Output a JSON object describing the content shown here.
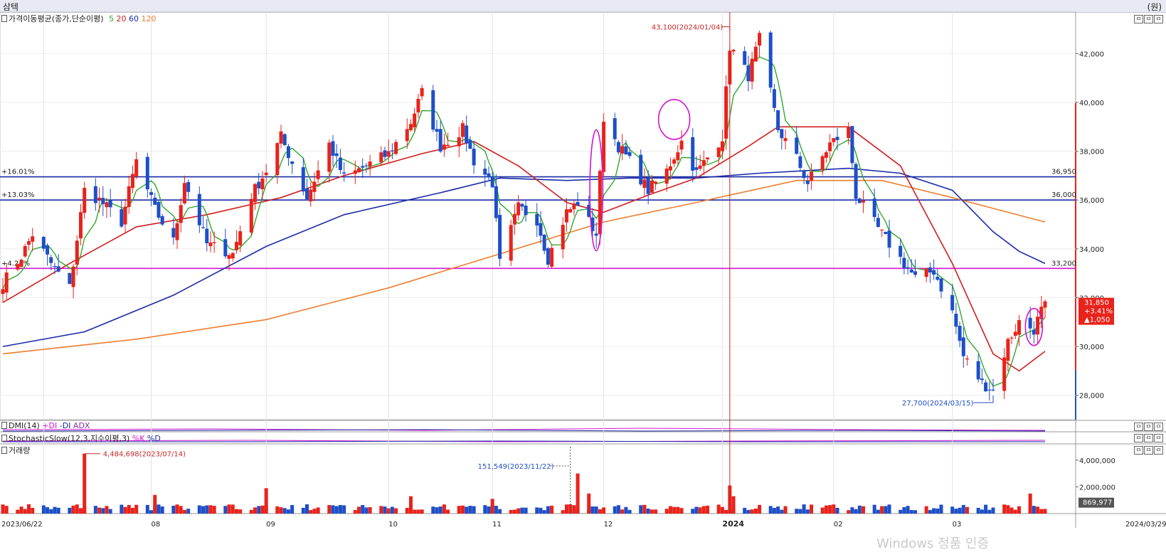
{
  "window": {
    "title": "삼텍",
    "unit": "(원)",
    "buttons": [
      "ㅁ",
      "ㅁ",
      "ㅁ"
    ]
  },
  "panels": {
    "price_label": "가격이동평균(종가,단순이평)",
    "ma_periods": [
      "5",
      "20",
      "60",
      "120"
    ],
    "dmi_label": "DMI(14)",
    "dmi_series": [
      "+DI",
      "-DI",
      "ADX"
    ],
    "stoch_label": "StochasticSlow(12,3,지수이평,3)",
    "stoch_series": [
      "%K",
      "%D"
    ],
    "volume_label": "거래량"
  },
  "watermark": "Windows 정품 인증",
  "colors": {
    "up": "#e8231b",
    "down": "#1e4fc8",
    "ma5": "#2fa82f",
    "ma20": "#d21e1e",
    "ma60": "#1a2aa8",
    "ma120": "#ef7d2e",
    "hline_blue": "#1a2aa8",
    "hline_magenta": "#d214d2",
    "marker": "#c82828",
    "highlight_circle": "#d214d2"
  },
  "chart_data": {
    "type": "candlestick",
    "price_axis": {
      "min": 27000,
      "max": 43700,
      "ticks": [
        28000,
        30000,
        32000,
        34000,
        36000,
        38000,
        40000,
        42000
      ],
      "tick_labels": [
        "28,000",
        "30,000",
        "32,000",
        "34,000",
        "36,000",
        "38,000",
        "40,000",
        "42,000"
      ]
    },
    "date_axis_labels": [
      "2023/06/22",
      "08",
      "09",
      "10",
      "11",
      "12",
      "2024",
      "02",
      "03",
      "2024/03/29"
    ],
    "anchor_points": [
      [
        "2023/06/22",
        32600
      ],
      [
        "2023/06/27",
        33700
      ],
      [
        "2023/06/30",
        34600
      ],
      [
        "2023/07/05",
        33400
      ],
      [
        "2023/07/10",
        32400
      ],
      [
        "2023/07/14",
        36400
      ],
      [
        "2023/07/18",
        36000
      ],
      [
        "2023/07/24",
        35100
      ],
      [
        "2023/07/28",
        37600
      ],
      [
        "2023/08/02",
        35600
      ],
      [
        "2023/08/07",
        34300
      ],
      [
        "2023/08/10",
        36800
      ],
      [
        "2023/08/16",
        34200
      ],
      [
        "2023/08/23",
        33800
      ],
      [
        "2023/08/28",
        36200
      ],
      [
        "2023/09/01",
        37200
      ],
      [
        "2023/09/05",
        38600
      ],
      [
        "2023/09/12",
        36100
      ],
      [
        "2023/09/18",
        38300
      ],
      [
        "2023/09/22",
        36900
      ],
      [
        "2023/10/04",
        37900
      ],
      [
        "2023/10/10",
        39200
      ],
      [
        "2023/10/13",
        40400
      ],
      [
        "2023/10/18",
        38200
      ],
      [
        "2023/10/24",
        38900
      ],
      [
        "2023/10/27",
        37600
      ],
      [
        "2023/11/01",
        36700
      ],
      [
        "2023/11/03",
        33400
      ],
      [
        "2023/11/08",
        35700
      ],
      [
        "2023/11/13",
        35200
      ],
      [
        "2023/11/16",
        33600
      ],
      [
        "2023/11/21",
        35500
      ],
      [
        "2023/11/24",
        35900
      ],
      [
        "2023/11/29",
        34600
      ],
      [
        "2023/12/01",
        39400
      ],
      [
        "2023/12/05",
        38200
      ],
      [
        "2023/12/08",
        37600
      ],
      [
        "2023/12/13",
        36400
      ],
      [
        "2023/12/18",
        37200
      ],
      [
        "2023/12/22",
        38400
      ],
      [
        "2023/12/26",
        37100
      ],
      [
        "2024/01/02",
        38600
      ],
      [
        "2024/01/04",
        42300
      ],
      [
        "2024/01/09",
        41100
      ],
      [
        "2024/01/12",
        42600
      ],
      [
        "2024/01/17",
        38900
      ],
      [
        "2024/01/22",
        37700
      ],
      [
        "2024/01/25",
        36700
      ],
      [
        "2024/01/31",
        38300
      ],
      [
        "2024/02/05",
        38900
      ],
      [
        "2024/02/07",
        36200
      ],
      [
        "2024/02/14",
        34600
      ],
      [
        "2024/02/19",
        33600
      ],
      [
        "2024/02/23",
        32800
      ],
      [
        "2024/02/28",
        33100
      ],
      [
        "2024/03/04",
        31400
      ],
      [
        "2024/03/07",
        29600
      ],
      [
        "2024/03/12",
        28500
      ],
      [
        "2024/03/15",
        28200
      ],
      [
        "2024/03/19",
        30200
      ],
      [
        "2024/03/22",
        31000
      ],
      [
        "2024/03/26",
        30700
      ],
      [
        "2024/03/29",
        31850
      ]
    ],
    "ma20_points": [
      [
        "2023/06/22",
        31800
      ],
      [
        "2023/07/10",
        33400
      ],
      [
        "2023/07/28",
        34900
      ],
      [
        "2023/08/16",
        35400
      ],
      [
        "2023/09/05",
        36100
      ],
      [
        "2023/09/22",
        37000
      ],
      [
        "2023/10/13",
        37900
      ],
      [
        "2023/10/27",
        38400
      ],
      [
        "2023/11/08",
        37400
      ],
      [
        "2023/11/21",
        35900
      ],
      [
        "2023/12/01",
        35500
      ],
      [
        "2023/12/13",
        36200
      ],
      [
        "2023/12/26",
        36900
      ],
      [
        "2024/01/09",
        38200
      ],
      [
        "2024/01/17",
        39000
      ],
      [
        "2024/01/31",
        39000
      ],
      [
        "2024/02/05",
        39000
      ],
      [
        "2024/02/19",
        37400
      ],
      [
        "2024/03/04",
        33400
      ],
      [
        "2024/03/15",
        29700
      ],
      [
        "2024/03/22",
        29000
      ],
      [
        "2024/03/29",
        29800
      ]
    ],
    "ma60_points": [
      [
        "2023/06/22",
        30000
      ],
      [
        "2023/07/14",
        30600
      ],
      [
        "2023/08/07",
        32100
      ],
      [
        "2023/09/01",
        34100
      ],
      [
        "2023/09/22",
        35400
      ],
      [
        "2023/10/18",
        36300
      ],
      [
        "2023/11/03",
        36900
      ],
      [
        "2023/11/21",
        36800
      ],
      [
        "2023/12/08",
        36900
      ],
      [
        "2023/12/26",
        36900
      ],
      [
        "2024/01/12",
        37100
      ],
      [
        "2024/02/05",
        37300
      ],
      [
        "2024/02/19",
        37100
      ],
      [
        "2024/03/04",
        36400
      ],
      [
        "2024/03/15",
        34700
      ],
      [
        "2024/03/22",
        33900
      ],
      [
        "2024/03/29",
        33400
      ]
    ],
    "ma120_points": [
      [
        "2023/06/22",
        29700
      ],
      [
        "2023/07/28",
        30300
      ],
      [
        "2023/09/01",
        31100
      ],
      [
        "2023/10/04",
        32400
      ],
      [
        "2023/11/01",
        33700
      ],
      [
        "2023/12/01",
        35100
      ],
      [
        "2023/12/26",
        35900
      ],
      [
        "2024/01/22",
        36800
      ],
      [
        "2024/02/14",
        36800
      ],
      [
        "2024/03/04",
        36100
      ],
      [
        "2024/03/29",
        35100
      ]
    ],
    "horizontal_lines": [
      {
        "label": "+16.01%",
        "value_label": "36,950",
        "price": 36950,
        "color": "hline_blue"
      },
      {
        "label": "+13.03%",
        "value_label": "36,000",
        "price": 36000,
        "color": "hline_blue"
      },
      {
        "label": "+4.24%",
        "value_label": "33,200",
        "price": 33200,
        "color": "hline_magenta"
      }
    ],
    "high_marker": {
      "label": "43,100(2024/01/04)",
      "date": "2024/01/04",
      "price": 43100
    },
    "low_marker": {
      "label": "27,700(2024/03/15)",
      "date": "2024/03/15",
      "price": 27700
    },
    "vertical_line_date": "2024/01/04",
    "current": {
      "price": "31,850",
      "change_pct": "+3.41%",
      "change": "▲1,050",
      "value": 31850
    },
    "volume_axis": {
      "max": 5000000,
      "ticks": [
        2000000,
        4000000
      ],
      "tick_labels": [
        "2,000,000",
        "4,000,000"
      ]
    },
    "volume_markers": [
      {
        "label": "4,484,698(2023/07/14)",
        "date": "2023/07/14",
        "value": 4484698
      },
      {
        "label": "151,549(2023/11/22)",
        "date": "2023/11/22",
        "value": 151549
      }
    ],
    "volume_spikes": [
      [
        "2023/07/14",
        4484698
      ],
      [
        "2023/08/02",
        1400000
      ],
      [
        "2023/09/01",
        1900000
      ],
      [
        "2023/10/10",
        1300000
      ],
      [
        "2023/11/01",
        1100000
      ],
      [
        "2023/11/24",
        3000000
      ],
      [
        "2023/11/27",
        1500000
      ],
      [
        "2024/01/04",
        2100000
      ],
      [
        "2024/01/05",
        1300000
      ],
      [
        "2024/03/25",
        1500000
      ]
    ],
    "current_volume": {
      "label": "869,977",
      "value": 869977
    },
    "circles": [
      {
        "date": "2023/11/29",
        "price": 36400
      },
      {
        "date": "2023/12/20",
        "price": 39300
      },
      {
        "date": "2024/03/26",
        "price": 30800
      }
    ]
  }
}
